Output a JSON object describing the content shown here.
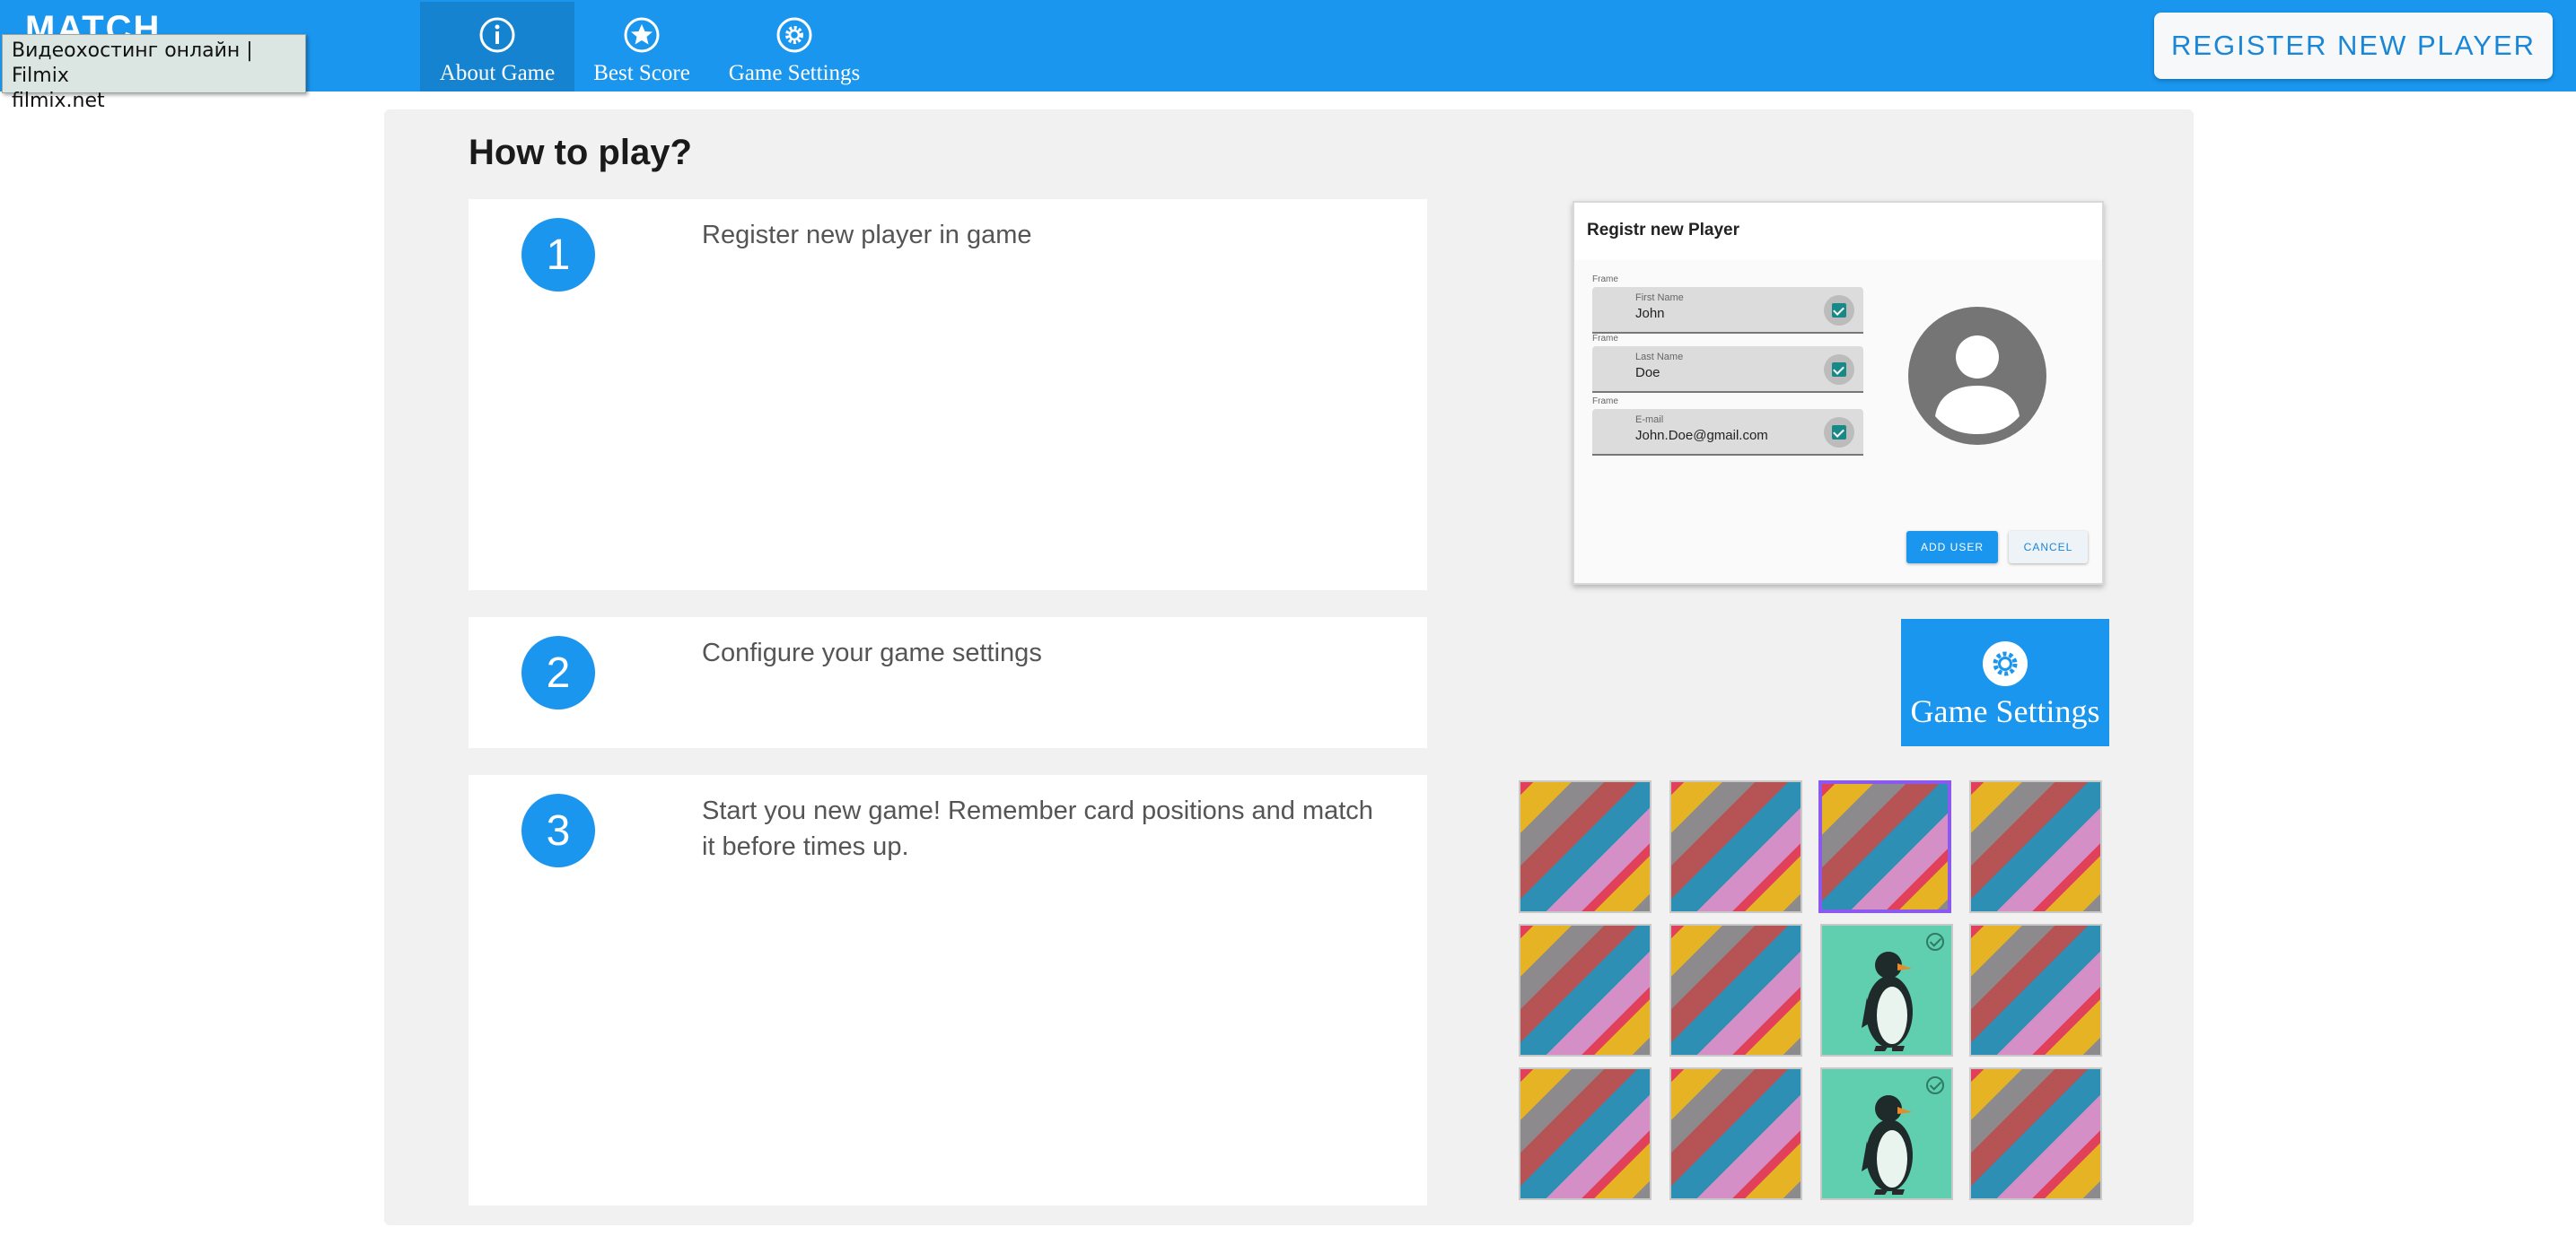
{
  "header": {
    "logo": "MATCH",
    "tooltip_line1": "Видеохостинг онлайн | Filmix",
    "tooltip_line2": "filmix.net",
    "nav": [
      {
        "label": "About Game",
        "icon": "info-icon",
        "active": true
      },
      {
        "label": "Best Score",
        "icon": "star-icon",
        "active": false
      },
      {
        "label": "Game Settings",
        "icon": "gear-icon",
        "active": false
      }
    ],
    "register_button": "REGISTER NEW PLAYER"
  },
  "main": {
    "title": "How to play?",
    "steps": [
      {
        "number": "1",
        "text": "Register new player in game"
      },
      {
        "number": "2",
        "text": "Configure your game settings"
      },
      {
        "number": "3",
        "text": "Start you new game! Remember card positions and match it before times up."
      }
    ]
  },
  "register_preview": {
    "title": "Registr new Player",
    "fields": [
      {
        "frame": "Frame",
        "label": "First Name",
        "value": "John"
      },
      {
        "frame": "Frame",
        "label": "Last Name",
        "value": "Doe"
      },
      {
        "frame": "Frame",
        "label": "E-mail",
        "value": "John.Doe@gmail.com"
      }
    ],
    "add_button": "ADD USER",
    "cancel_button": "CANCEL"
  },
  "settings_tile": {
    "label": "Game Settings",
    "icon": "gear-icon"
  },
  "cards": {
    "rows": 3,
    "cols": 4,
    "faces": [
      "back",
      "back",
      "back-selected",
      "back",
      "back",
      "back",
      "penguin-matched",
      "back",
      "back",
      "back",
      "penguin-matched",
      "back"
    ]
  },
  "colors": {
    "primary": "#1a96ef",
    "panel": "#f1f1f1",
    "matched": "#5fcfaf",
    "selected": "#8c59f0"
  }
}
